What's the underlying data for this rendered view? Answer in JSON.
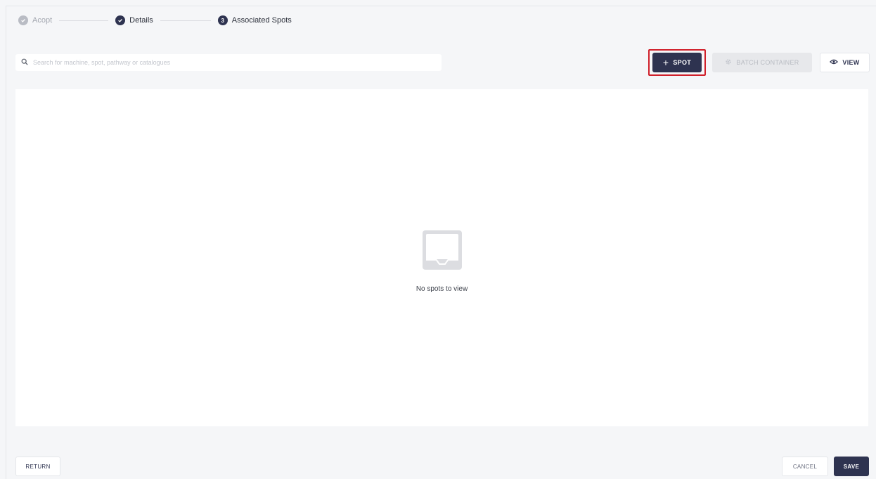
{
  "stepper": {
    "steps": [
      {
        "label": "Acopt",
        "state": "complete"
      },
      {
        "label": "Details",
        "state": "complete"
      },
      {
        "label": "Associated Spots",
        "number": "3",
        "state": "active"
      }
    ]
  },
  "search": {
    "placeholder": "Search for machine, spot, pathway or catalogues",
    "value": ""
  },
  "toolbar": {
    "spot_label": "SPOT",
    "batch_label": "BATCH CONTAINER",
    "view_label": "VIEW"
  },
  "main": {
    "empty_message": "No spots to view"
  },
  "footer": {
    "return_label": "RETURN",
    "cancel_label": "CANCEL",
    "save_label": "SAVE"
  },
  "colors": {
    "primary": "#2e3350",
    "highlight": "#d0202a",
    "background": "#f5f6f8",
    "disabled": "#e7e8eb"
  }
}
